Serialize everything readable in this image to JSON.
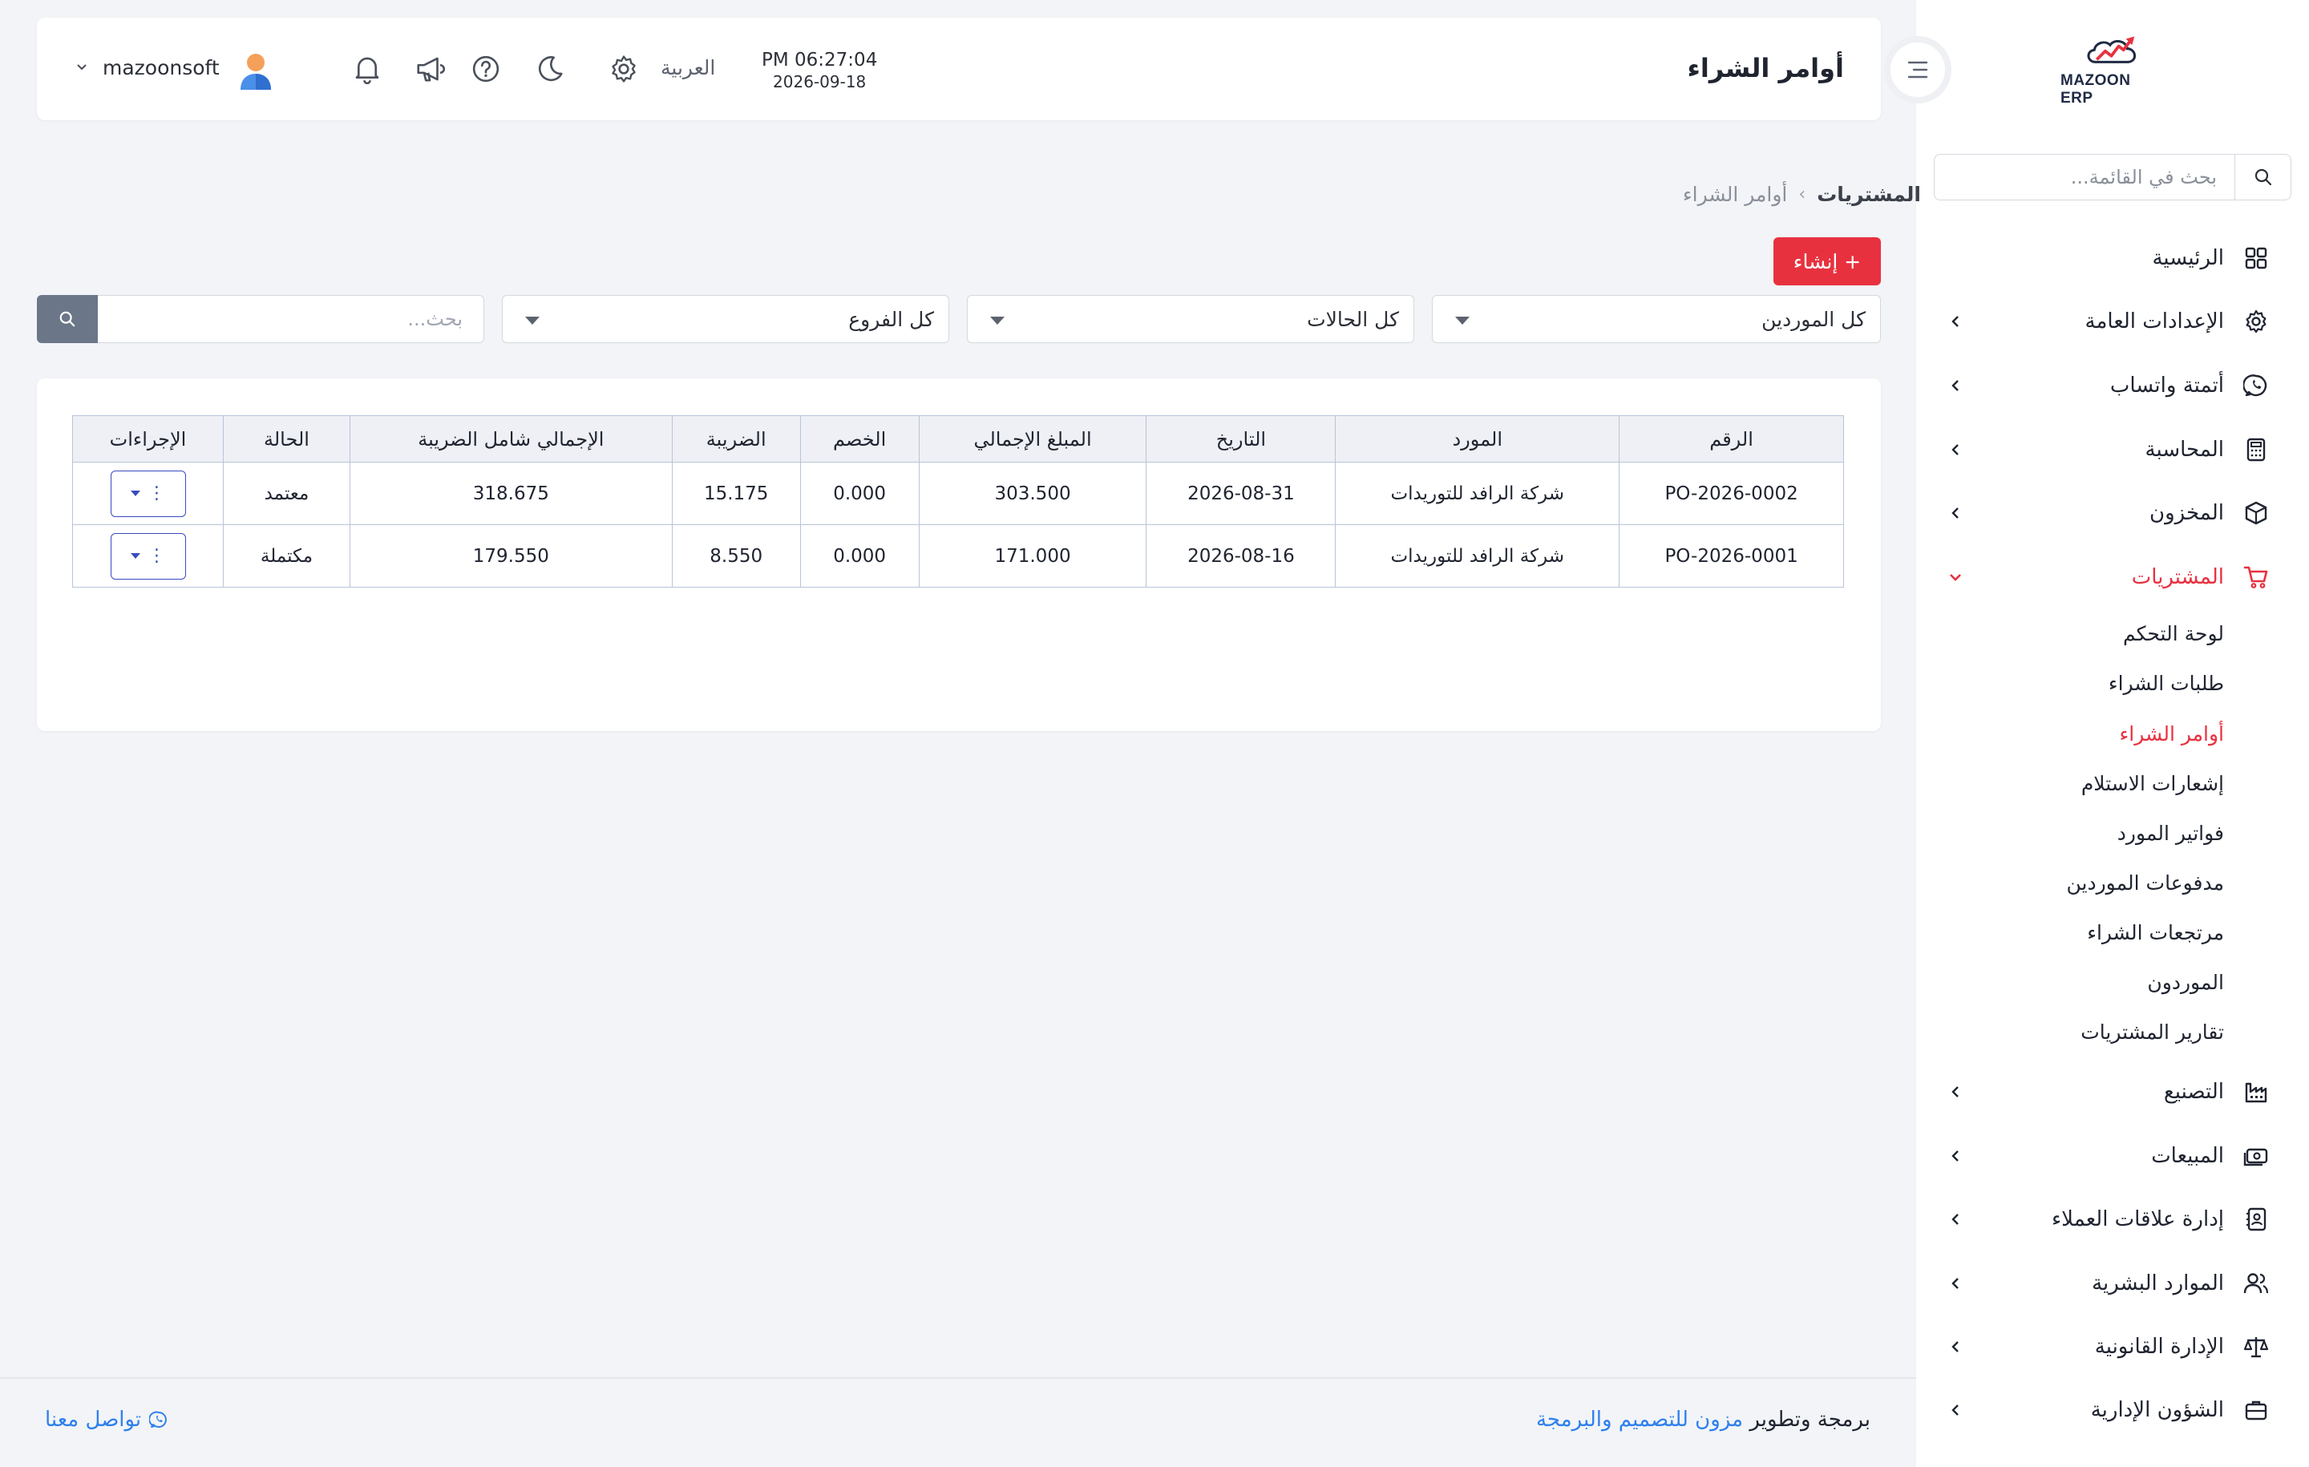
{
  "brand": {
    "logo_text": "MAZOON ERP",
    "logo_tag": "ERP ERP",
    "accent": "#e8313f"
  },
  "sidebar": {
    "search_placeholder": "بحث في القائمة...",
    "items": [
      {
        "label": "الرئيسية",
        "icon": "grid-icon",
        "has_chevron": false
      },
      {
        "label": "الإعدادات العامة",
        "icon": "gear-icon",
        "has_chevron": true
      },
      {
        "label": "أتمتة واتساب",
        "icon": "whatsapp-icon",
        "has_chevron": true
      },
      {
        "label": "المحاسبة",
        "icon": "calculator-icon",
        "has_chevron": true
      },
      {
        "label": "المخزون",
        "icon": "box-icon",
        "has_chevron": true
      },
      {
        "label": "المشتريات",
        "icon": "cart-icon",
        "has_chevron": true,
        "expanded": true,
        "active": true
      },
      {
        "label": "التصنيع",
        "icon": "factory-icon",
        "has_chevron": true
      },
      {
        "label": "المبيعات",
        "icon": "cash-icon",
        "has_chevron": true
      },
      {
        "label": "إدارة علاقات العملاء",
        "icon": "contacts-icon",
        "has_chevron": true
      },
      {
        "label": "الموارد البشرية",
        "icon": "users-icon",
        "has_chevron": true
      },
      {
        "label": "الإدارة القانونية",
        "icon": "scale-icon",
        "has_chevron": true
      },
      {
        "label": "الشؤون الإدارية",
        "icon": "briefcase-icon",
        "has_chevron": true
      }
    ],
    "purchases_sub": [
      {
        "label": "لوحة التحكم"
      },
      {
        "label": "طلبات الشراء"
      },
      {
        "label": "أوامر الشراء",
        "active": true
      },
      {
        "label": "إشعارات الاستلام"
      },
      {
        "label": "فواتير المورد"
      },
      {
        "label": "مدفوعات الموردين"
      },
      {
        "label": "مرتجعات الشراء"
      },
      {
        "label": "الموردون"
      },
      {
        "label": "تقارير المشتريات"
      }
    ]
  },
  "header": {
    "title": "أوامر الشراء",
    "time": "PM 06:27:04",
    "date": "2026-09-18",
    "language": "العربية",
    "username": "mazoonsoft"
  },
  "breadcrumb": {
    "parent": "المشتريات",
    "separator": "›",
    "current": "أوامر الشراء"
  },
  "toolbar": {
    "create_label": "+ إنشاء"
  },
  "filters": {
    "supplier": "كل الموردين",
    "status": "كل الحالات",
    "branch": "كل الفروع",
    "search_placeholder": "بحث..."
  },
  "table": {
    "columns": [
      "الرقم",
      "المورد",
      "التاريخ",
      "المبلغ الإجمالي",
      "الخصم",
      "الضريبة",
      "الإجمالي شامل الضريبة",
      "الحالة",
      "الإجراءات"
    ],
    "rows": [
      {
        "number": "PO-2026-0002",
        "supplier": "شركة الرافد للتوريدات",
        "date": "2026-08-31",
        "amount": "303.500",
        "discount": "0.000",
        "tax": "15.175",
        "total": "318.675",
        "status": "معتمد"
      },
      {
        "number": "PO-2026-0001",
        "supplier": "شركة الرافد للتوريدات",
        "date": "2026-08-16",
        "amount": "171.000",
        "discount": "0.000",
        "tax": "8.550",
        "total": "179.550",
        "status": "مكتملة"
      }
    ],
    "action_dots": "⋮"
  },
  "footer": {
    "credit_prefix": "برمجة وتطوير",
    "credit_link": "مزون للتصميم والبرمجة",
    "contact": "تواصل معنا"
  }
}
